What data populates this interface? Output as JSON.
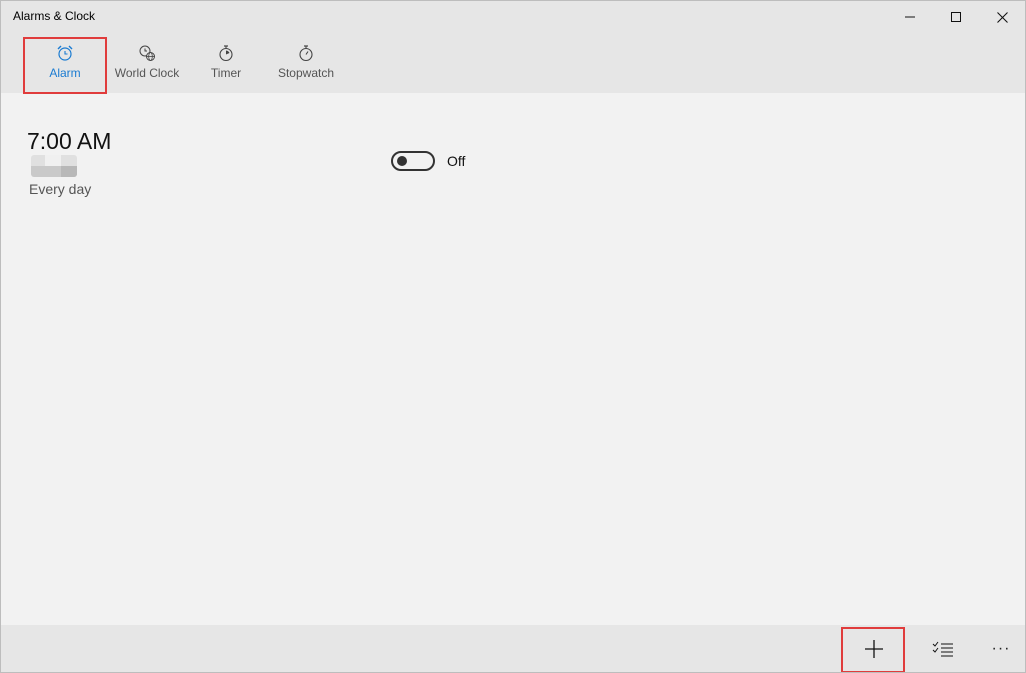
{
  "window": {
    "title": "Alarms & Clock",
    "controls": {
      "minimize": "minimize-icon",
      "maximize": "maximize-icon",
      "close": "close-icon"
    }
  },
  "tabs": [
    {
      "label": "Alarm",
      "icon": "alarm-clock-icon",
      "selected": true
    },
    {
      "label": "World Clock",
      "icon": "world-clock-icon",
      "selected": false
    },
    {
      "label": "Timer",
      "icon": "timer-icon",
      "selected": false
    },
    {
      "label": "Stopwatch",
      "icon": "stopwatch-icon",
      "selected": false
    }
  ],
  "alarms": [
    {
      "time": "7:00 AM",
      "repeat": "Every day",
      "enabled": false,
      "state_label": "Off"
    }
  ],
  "command_bar": {
    "add": {
      "glyph": "+",
      "icon": "add-icon"
    },
    "select": {
      "icon": "select-list-icon"
    },
    "more": {
      "glyph": "···",
      "icon": "more-icon"
    }
  },
  "colors": {
    "accent": "#1a7bd1",
    "highlight": "#e03c3c",
    "chrome": "#e6e6e6",
    "content": "#f2f2f2"
  }
}
